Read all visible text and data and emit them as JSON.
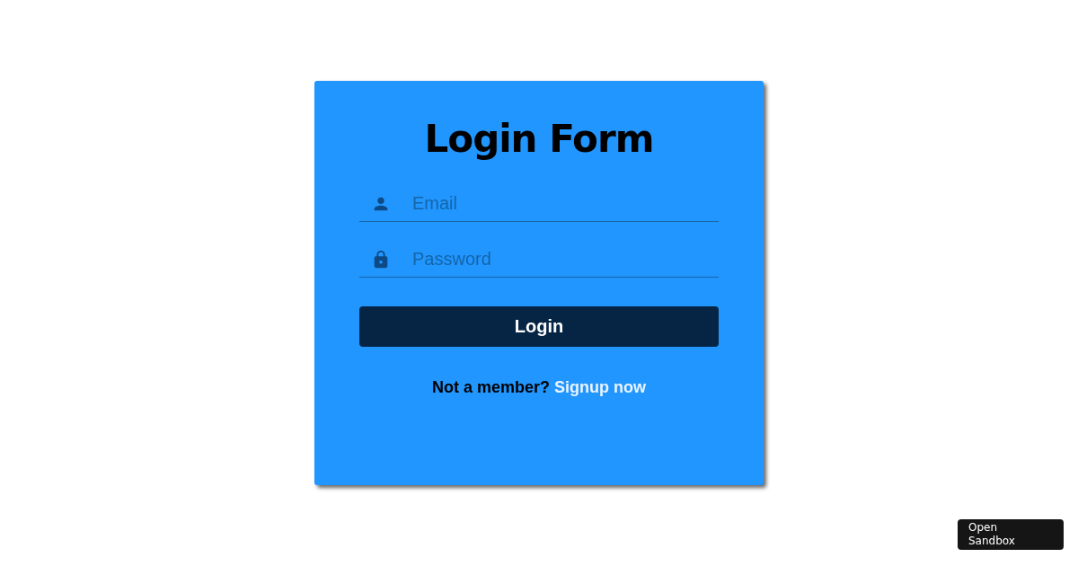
{
  "form": {
    "title": "Login Form",
    "fields": [
      {
        "kind": "email",
        "placeholder": "Email"
      },
      {
        "kind": "password",
        "placeholder": "Password"
      }
    ],
    "submit": "Login",
    "signup_prompt": "Not a member?",
    "signup_link": "Signup now"
  },
  "sandbox_button": "Open Sandbox"
}
